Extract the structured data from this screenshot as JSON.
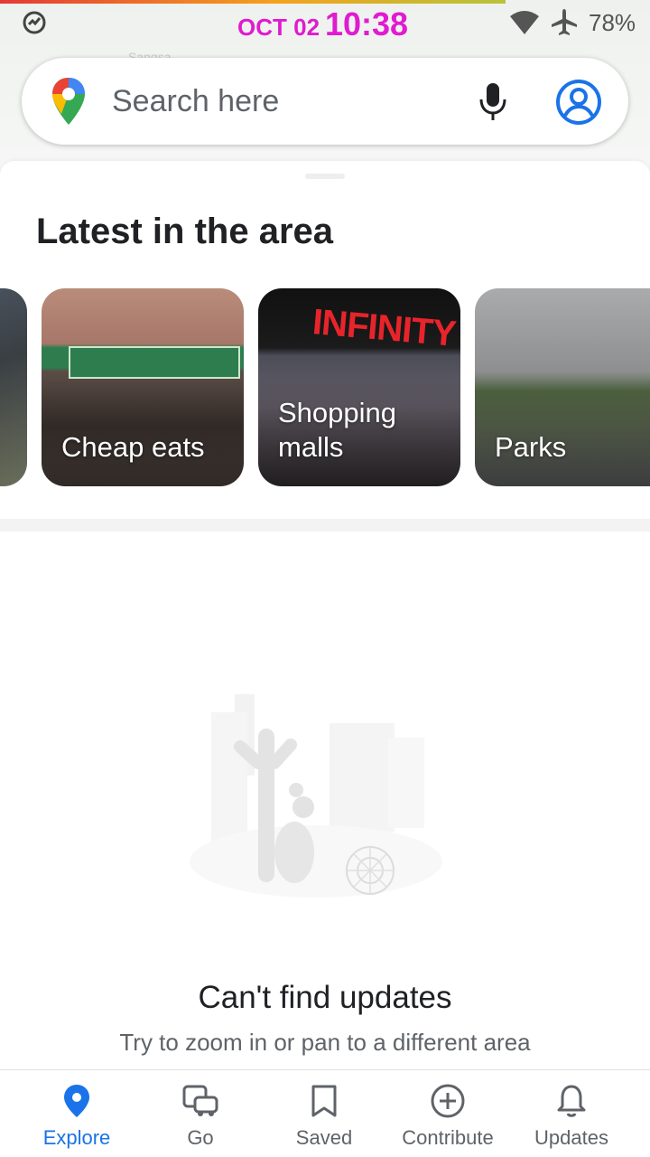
{
  "status_bar": {
    "date": "OCT 02",
    "time": "10:38",
    "battery": "78%",
    "icons": [
      "sync-icon",
      "wifi-icon",
      "airplane-mode-icon"
    ]
  },
  "map": {
    "label": "Sangsa"
  },
  "search": {
    "placeholder": "Search here",
    "icons": [
      "google-maps-pin-icon",
      "microphone-icon",
      "account-icon"
    ]
  },
  "latest": {
    "title": "Latest in the area",
    "cards": [
      {
        "label": "Cheap eats"
      },
      {
        "label": "Shopping malls"
      },
      {
        "label": "Parks"
      }
    ],
    "mall_sign": "INFINITY"
  },
  "empty_state": {
    "title": "Can't find updates",
    "subtitle": "Try to zoom in or pan to a different area"
  },
  "bottom_nav": {
    "items": [
      {
        "label": "Explore",
        "icon": "explore-pin-icon",
        "active": true
      },
      {
        "label": "Go",
        "icon": "car-bus-icon",
        "active": false
      },
      {
        "label": "Saved",
        "icon": "bookmark-icon",
        "active": false
      },
      {
        "label": "Contribute",
        "icon": "add-circle-icon",
        "active": false
      },
      {
        "label": "Updates",
        "icon": "bell-icon",
        "active": false
      }
    ]
  },
  "colors": {
    "accent": "#1a73e8",
    "status_time": "#e01bd0",
    "text_primary": "#202124",
    "text_secondary": "#5f6368"
  }
}
